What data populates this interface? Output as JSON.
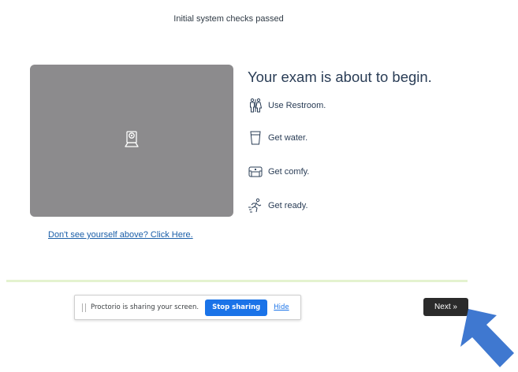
{
  "status": {
    "text": "Initial system checks passed"
  },
  "camera": {
    "help_link": "Don't see yourself above? Click Here."
  },
  "intro": {
    "heading": "Your exam is about to begin.",
    "steps": [
      {
        "icon": "restroom-icon",
        "label": "Use Restroom."
      },
      {
        "icon": "water-glass-icon",
        "label": "Get water."
      },
      {
        "icon": "sofa-icon",
        "label": "Get comfy."
      },
      {
        "icon": "runner-icon",
        "label": "Get ready."
      }
    ]
  },
  "share_bar": {
    "message": "Proctorio is sharing your screen.",
    "stop_label": "Stop sharing",
    "hide_label": "Hide"
  },
  "navigation": {
    "next_label": "Next »"
  },
  "colors": {
    "camera_bg": "#8c8b8d",
    "heading": "#2a3d56",
    "link": "#1a5ea8",
    "divider": "#e4f2cf",
    "stop_button": "#1a73e8",
    "next_button": "#2b2b2b",
    "arrow": "#3f78d0"
  }
}
